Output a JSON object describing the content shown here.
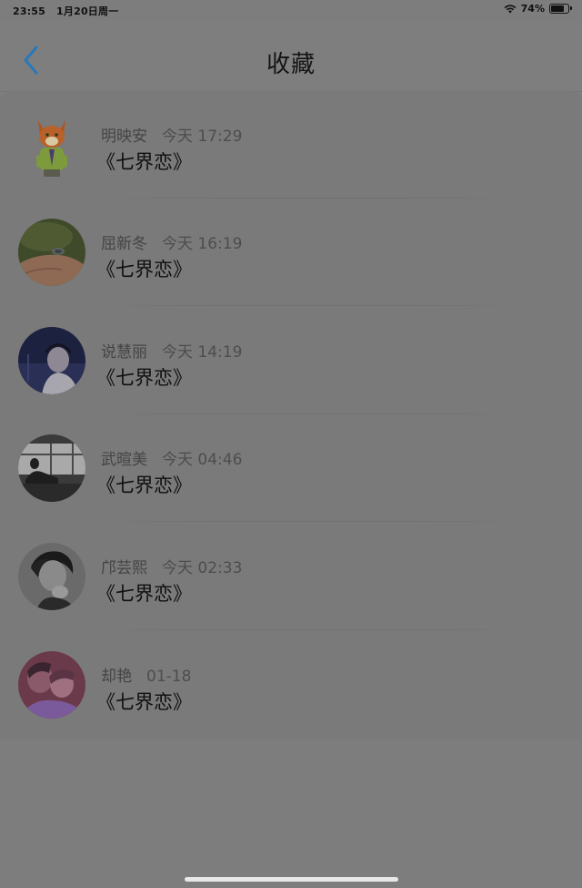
{
  "status_bar": {
    "time": "23:55",
    "date": "1月20日周一",
    "battery": "74%"
  },
  "header": {
    "title": "收藏"
  },
  "items": [
    {
      "name": "明映安",
      "time": "今天 17:29",
      "title": "《七界恋》"
    },
    {
      "name": "屈新冬",
      "time": "今天 16:19",
      "title": "《七界恋》"
    },
    {
      "name": "说慧丽",
      "time": "今天 14:19",
      "title": "《七界恋》"
    },
    {
      "name": "武暄美",
      "time": "今天 04:46",
      "title": "《七界恋》"
    },
    {
      "name": "邝芸熙",
      "time": "今天 02:33",
      "title": "《七界恋》"
    },
    {
      "name": "却艳",
      "time": "01-18",
      "title": "《七界恋》"
    }
  ],
  "icons": {
    "back": "chevron-left-icon",
    "wifi": "wifi-icon",
    "battery": "battery-icon"
  },
  "colors": {
    "accent": "#2b78b8"
  }
}
